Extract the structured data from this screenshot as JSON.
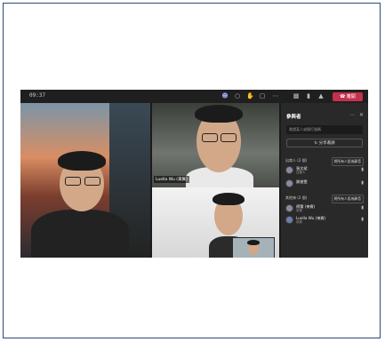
{
  "meeting": {
    "timer": "09:37",
    "leave_label": "離開",
    "toolbar_icons": [
      "people-icon",
      "chat-icon",
      "reactions-icon",
      "rooms-icon",
      "more-icon",
      "camera-icon",
      "mic-icon",
      "share-icon"
    ]
  },
  "videos": [
    {
      "name": ""
    },
    {
      "name": "Luella Wu (來賓)"
    },
    {
      "name": ""
    }
  ],
  "panel": {
    "title": "參與者",
    "search_placeholder": "邀請某人或撥打號碼",
    "share_label": "分享邀請",
    "groups": [
      {
        "header": "出席人 (2 個)",
        "action": "將所有人設為靜音",
        "people": [
          {
            "name": "張文斌",
            "sub": "召集人"
          },
          {
            "name": "謝俊雯",
            "sub": ""
          }
        ]
      },
      {
        "header": "其他來 (2 個)",
        "action": "將所有人設為靜音",
        "people": [
          {
            "name": "傅賢 (來賓)",
            "sub": "來賓"
          },
          {
            "name": "Luella Wu (來賓)",
            "sub": "來賓"
          }
        ]
      }
    ]
  },
  "colors": {
    "accent": "#c4314b",
    "panel_bg": "#292929",
    "bar_bg": "#1f1f1f"
  }
}
